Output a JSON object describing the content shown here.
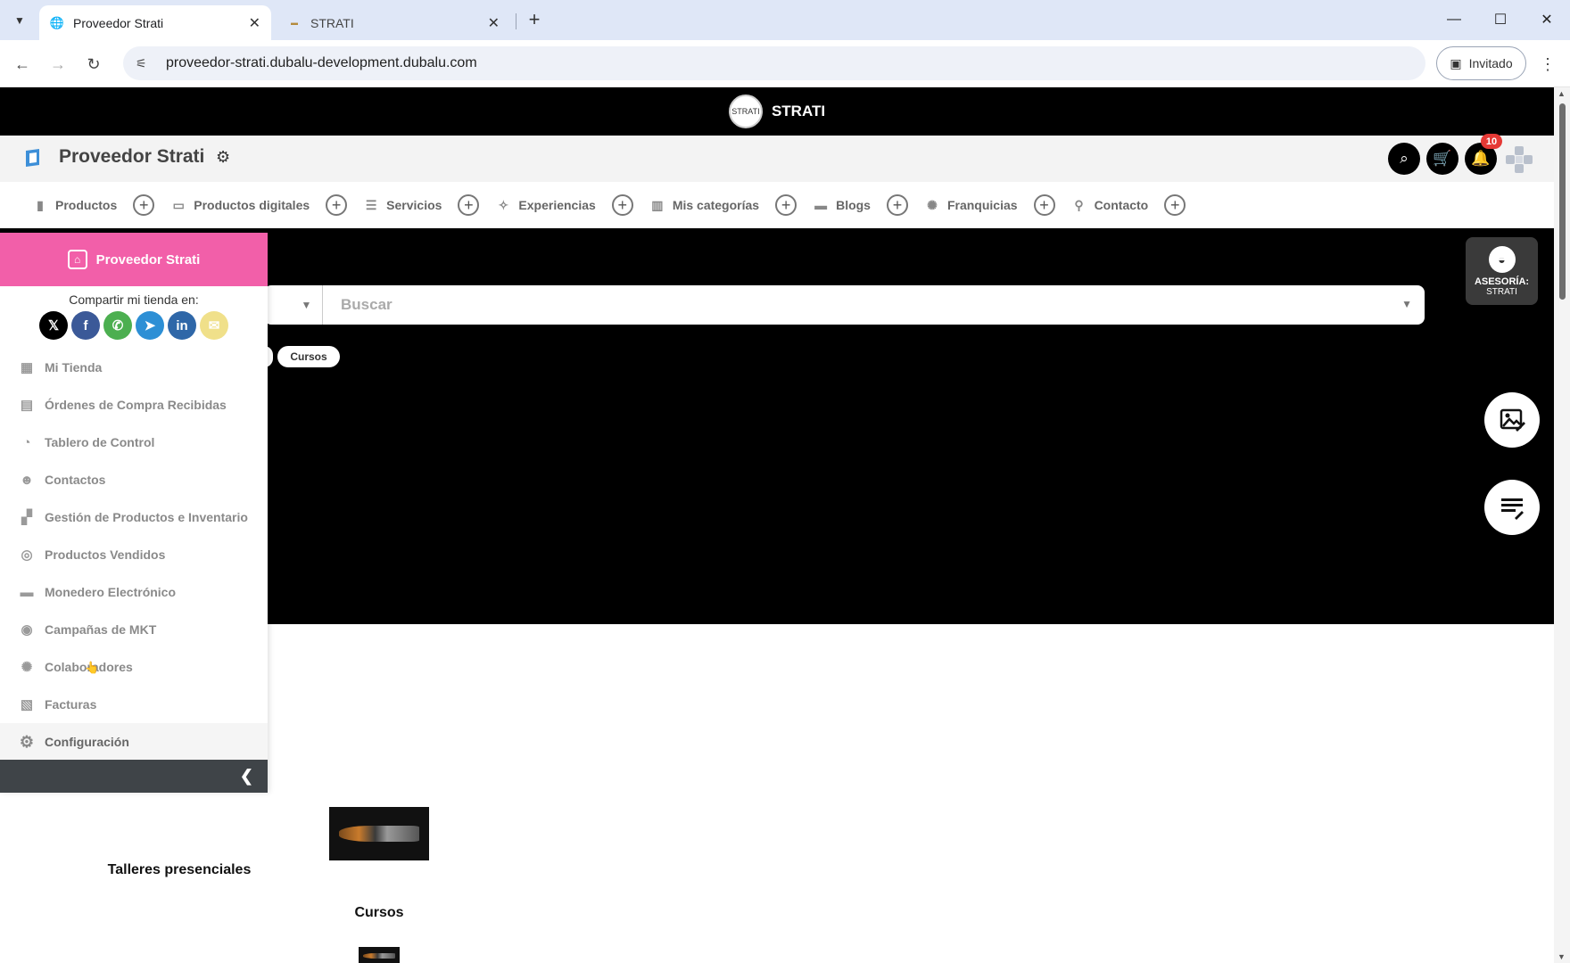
{
  "browser": {
    "tabs": [
      {
        "title": "Proveedor Strati",
        "active": true
      },
      {
        "title": "STRATI",
        "active": false
      }
    ],
    "url": "proveedor-strati.dubalu-development.dubalu.com",
    "profile_label": "Invitado"
  },
  "brand": {
    "name": "STRATI",
    "logo_text": "STRATI"
  },
  "store": {
    "name": "Proveedor Strati",
    "notification_count": "10"
  },
  "category_nav": [
    {
      "label": "Productos",
      "icon": "bag-icon"
    },
    {
      "label": "Productos digitales",
      "icon": "digital-icon"
    },
    {
      "label": "Servicios",
      "icon": "services-icon"
    },
    {
      "label": "Experiencias",
      "icon": "experience-icon"
    },
    {
      "label": "Mis categorías",
      "icon": "categories-icon"
    },
    {
      "label": "Blogs",
      "icon": "blog-icon"
    },
    {
      "label": "Franquicias",
      "icon": "franchise-icon"
    },
    {
      "label": "Contacto",
      "icon": "location-icon"
    }
  ],
  "search": {
    "placeholder": "Buscar"
  },
  "chips": [
    "Cursos"
  ],
  "asesoria": {
    "line1": "ASESORÍA:",
    "line2": "STRATI"
  },
  "sidebar": {
    "title": "Proveedor Strati",
    "share_label": "Compartir mi tienda en:",
    "social": [
      {
        "name": "x",
        "glyph": "𝕏",
        "color": "#000000"
      },
      {
        "name": "facebook",
        "glyph": "f",
        "color": "#3b5998"
      },
      {
        "name": "whatsapp",
        "glyph": "✆",
        "color": "#4caf50"
      },
      {
        "name": "telegram",
        "glyph": "➤",
        "color": "#2d8fd5"
      },
      {
        "name": "linkedin",
        "glyph": "in",
        "color": "#2f67a8"
      },
      {
        "name": "email",
        "glyph": "✉",
        "color": "#f0e08a"
      }
    ],
    "menu": [
      {
        "label": "Mi Tienda",
        "icon": "▦"
      },
      {
        "label": "Órdenes de Compra Recibidas",
        "icon": "▤"
      },
      {
        "label": "Tablero de Control",
        "icon": "◔"
      },
      {
        "label": "Contactos",
        "icon": "☻"
      },
      {
        "label": "Gestión de Productos e Inventario",
        "icon": "▞"
      },
      {
        "label": "Productos Vendidos",
        "icon": "◎"
      },
      {
        "label": "Monedero Electrónico",
        "icon": "▬"
      },
      {
        "label": "Campañas de MKT",
        "icon": "◉"
      },
      {
        "label": "Colaboradores",
        "icon": "✺"
      },
      {
        "label": "Facturas",
        "icon": "▧"
      },
      {
        "label": "Configuración",
        "icon": "⚙"
      }
    ]
  },
  "categories": [
    {
      "title": "Talleres presenciales"
    },
    {
      "title": "Cursos"
    }
  ]
}
